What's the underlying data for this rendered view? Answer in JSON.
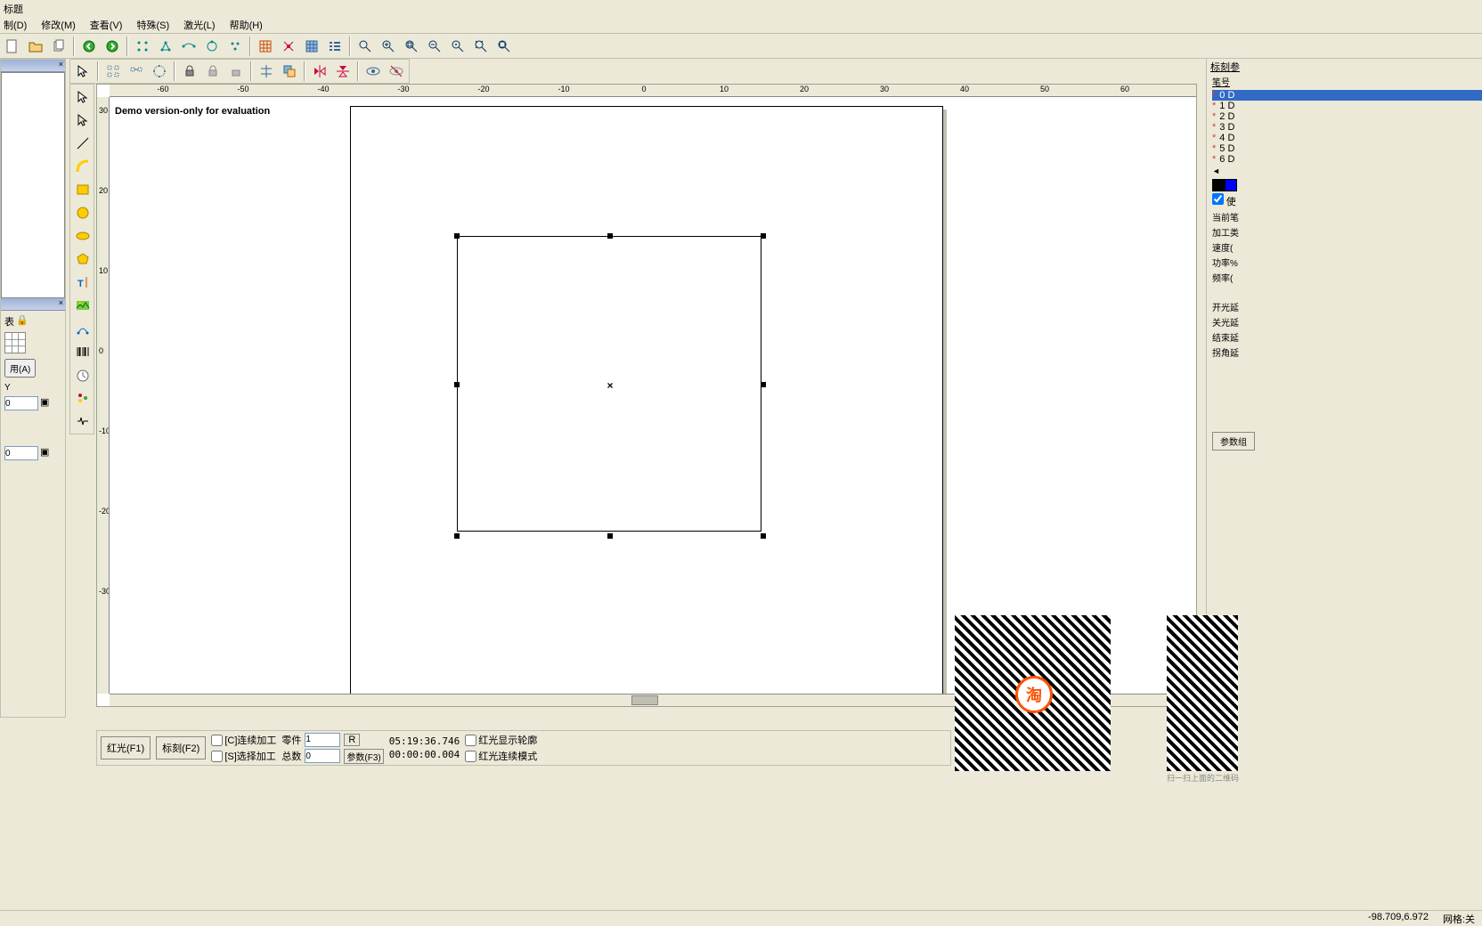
{
  "title": "标题",
  "menu": [
    "制(D)",
    "修改(M)",
    "查看(V)",
    "特殊(S)",
    "激光(L)",
    "帮助(H)"
  ],
  "toolbar1_icons": [
    "new-icon",
    "open-icon",
    "copy-icon",
    "",
    "undo-icon",
    "redo-icon",
    "",
    "node1-icon",
    "node2-icon",
    "node3-icon",
    "node4-icon",
    "node5-icon",
    "",
    "hatch-icon",
    "config-icon",
    "grid-icon",
    "list-icon",
    "",
    "zoom-icon",
    "zoom-in-icon",
    "zoom-fit-icon",
    "zoom-out-icon",
    "zoom-sel-icon",
    "zoom-all-icon",
    "zoom-ext-icon"
  ],
  "toolbar2_icons": [
    "cursor-icon",
    "",
    "array1-icon",
    "array2-icon",
    "array3-icon",
    "",
    "lock-icon",
    "lock2-icon",
    "lock3-icon",
    "",
    "align-icon",
    "layer-icon",
    "",
    "mirror-h-icon",
    "mirror-v-icon",
    "",
    "eye-icon",
    "eye-off-icon"
  ],
  "tools": [
    "select-icon",
    "node-edit-icon",
    "line-icon",
    "curve-icon",
    "rect-icon",
    "circle-icon",
    "ellipse-icon",
    "polygon-icon",
    "text-icon",
    "image-icon",
    "vector-icon",
    "barcode-icon",
    "timer-icon",
    "io-icon",
    "encoder-icon"
  ],
  "canvas": {
    "demo_label": "Demo version-only for evaluation",
    "ruler_ticks": [
      "-60",
      "-50",
      "-40",
      "-30",
      "-20",
      "-10",
      "0",
      "10",
      "20",
      "30",
      "40",
      "50",
      "60"
    ]
  },
  "right": {
    "header": "标刻参",
    "pen_col_hdr": "笔号",
    "pens": [
      "0 D",
      "1 D",
      "2 D",
      "3 D",
      "4 D",
      "5 D",
      "6 D"
    ],
    "colors": [
      "#000000",
      "#0000ff"
    ],
    "use_default": "使",
    "labels": [
      "当前笔",
      "加工类",
      "速度(",
      "功率%",
      "频率("
    ],
    "labels2": [
      "开光延",
      "关光延",
      "结束延",
      "拐角延"
    ],
    "param_btn": "参数组"
  },
  "left_dock": {
    "panel2_label": "表",
    "apply_btn": "用(A)",
    "val1": "0",
    "val2": "0"
  },
  "bottom": {
    "red_f1": "红光(F1)",
    "mark_f2": "标刻(F2)",
    "cont_proc": "[C]连续加工",
    "sel_proc": "[S]选择加工",
    "parts": "零件",
    "parts_val": "1",
    "r_btn": "R",
    "total": "总数",
    "total_val": "0",
    "param_f3": "参数(F3)",
    "time1": "05:19:36.746",
    "time2": "00:00:00.004",
    "red_outline": "红光显示轮廓",
    "red_cont": "红光连续模式"
  },
  "status": {
    "coords": "-98.709,6.972",
    "grid": "网格:关"
  },
  "qr_caption": "扫一扫上面的二维码"
}
